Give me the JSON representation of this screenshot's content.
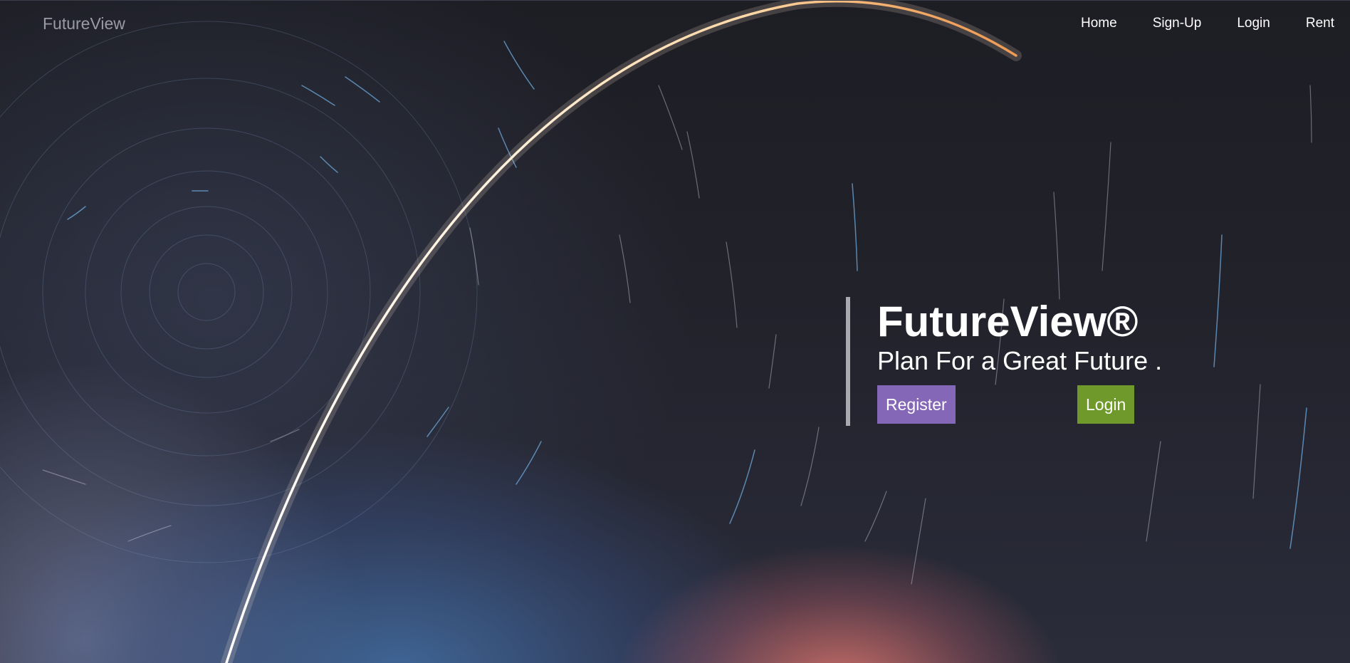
{
  "header": {
    "brand": "FutureView",
    "nav": [
      {
        "label": "Home"
      },
      {
        "label": "Sign-Up"
      },
      {
        "label": "Login"
      },
      {
        "label": "Rent"
      }
    ]
  },
  "hero": {
    "title": "FutureView®",
    "subtitle": "Plan For a Great Future .",
    "register_label": "Register",
    "login_label": "Login"
  },
  "colors": {
    "register_button": "#8567b7",
    "login_button": "#6f9a2b",
    "accent_bar": "#a9a9b0",
    "brand_text": "#9a9aa6"
  },
  "icons": {
    "background": "night-sky-star-trails-rocket-arc-image"
  }
}
